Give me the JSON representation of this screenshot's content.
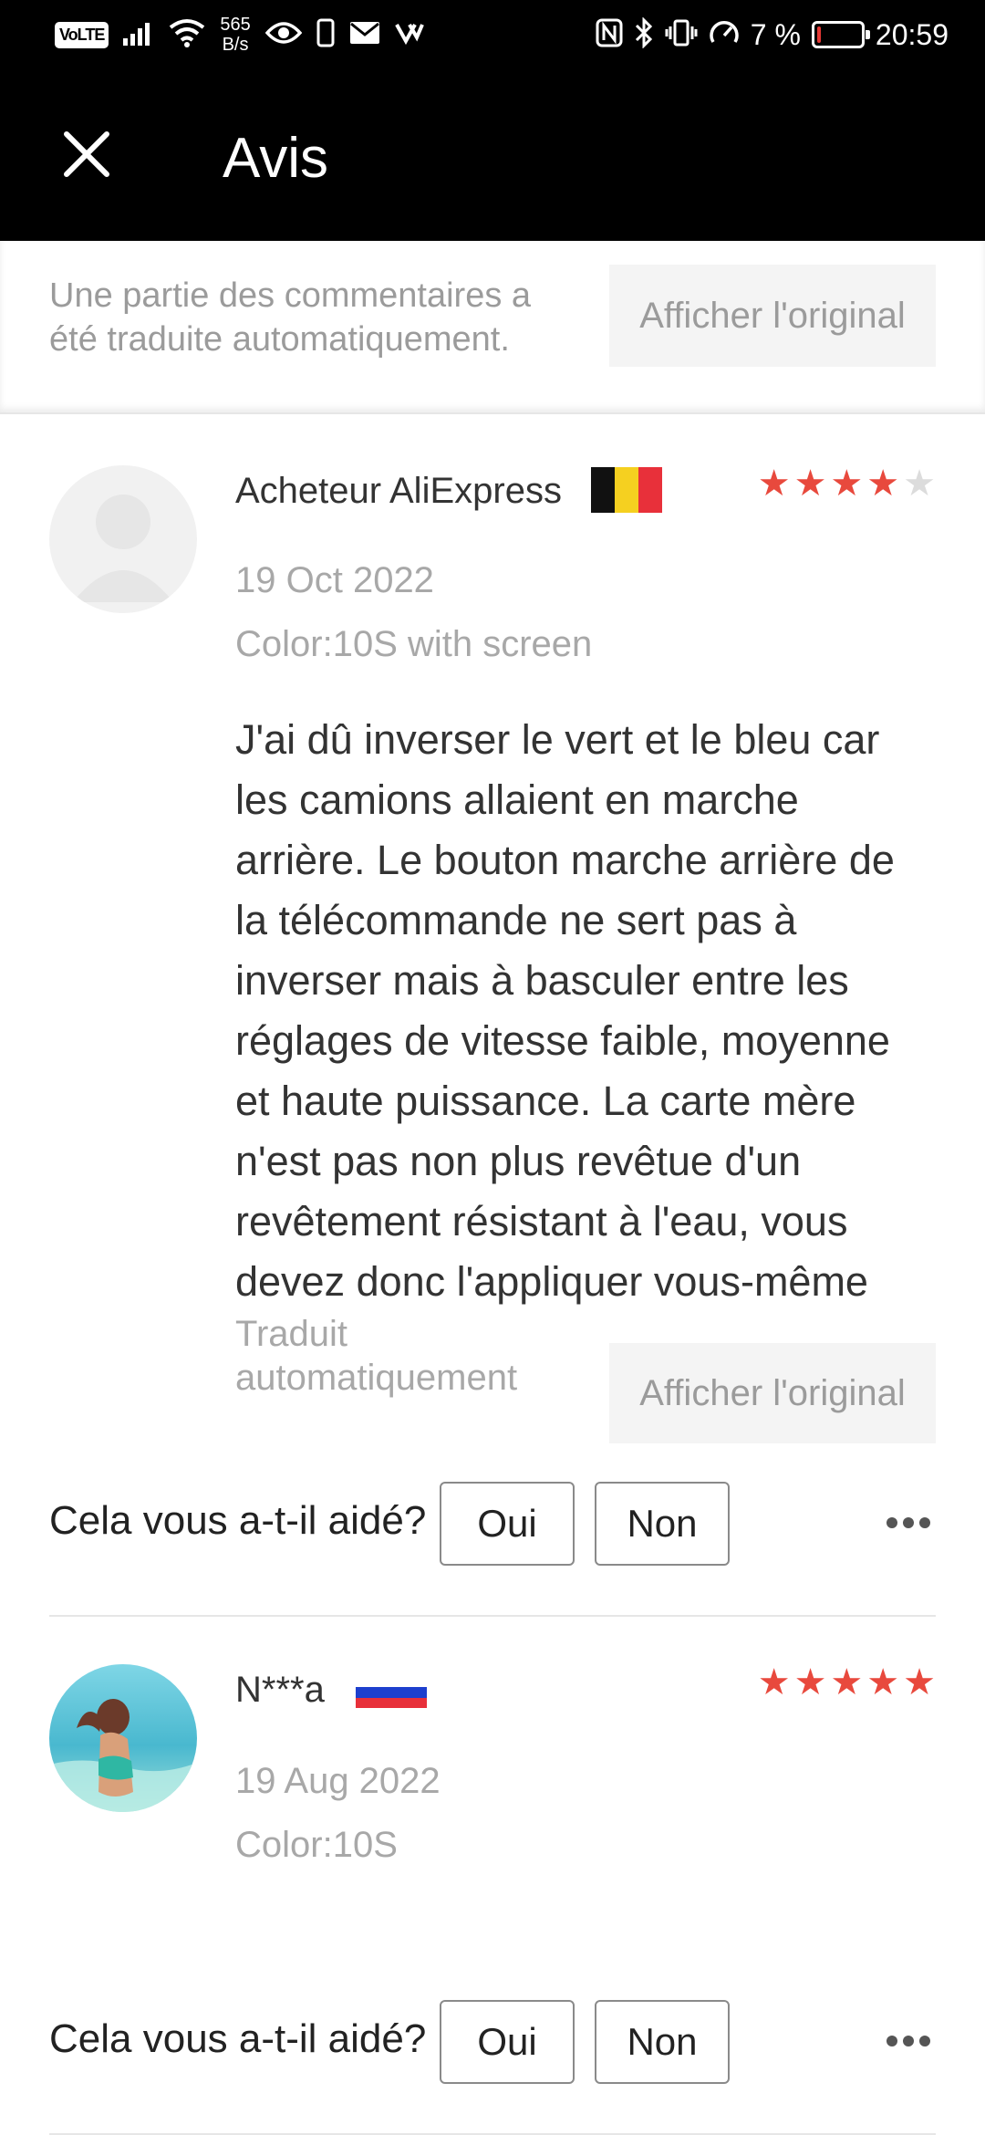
{
  "status_bar": {
    "volte": "VoLTE",
    "net_speed_value": "565",
    "net_speed_unit": "B/s",
    "battery_text": "7 %",
    "battery_level": 0.07,
    "time": "20:59"
  },
  "header": {
    "title": "Avis",
    "close_icon": "close-icon"
  },
  "banner": {
    "message": "Une partie des commentaires a été traduite automatiquement.",
    "button_label": "Afficher l'original"
  },
  "reviews": [
    {
      "reviewer": "Acheteur AliExpress",
      "flag": "belgium-flag",
      "rating": 4,
      "max_rating": 5,
      "date": "19 Oct 2022",
      "variant": "Color:10S with screen",
      "text": "J'ai dû inverser le vert et le bleu car les camions allaient en marche arrière. Le bouton marche arrière de la télécommande ne sert pas à inverser mais à basculer entre les réglages de vitesse faible, moyenne et haute puissance. La carte mère n'est pas non plus revêtue d'un revêtement résistant à l'eau, vous devez donc l'appliquer vous-même",
      "translated_label": "Traduit automatiquement",
      "show_original_label": "Afficher l'original",
      "helpful_question": "Cela vous a-t-il aidé?",
      "yes_label": "Oui",
      "no_label": "Non"
    },
    {
      "reviewer": "N***a",
      "flag": "russia-flag",
      "rating": 5,
      "max_rating": 5,
      "date": "19 Aug 2022",
      "variant": "Color:10S",
      "helpful_question": "Cela vous a-t-il aidé?",
      "yes_label": "Oui",
      "no_label": "Non"
    }
  ],
  "colors": {
    "star_active": "#e8493d",
    "star_inactive": "#dcdcdc",
    "header_bg": "#000000",
    "muted_text": "#a8a8a8"
  }
}
